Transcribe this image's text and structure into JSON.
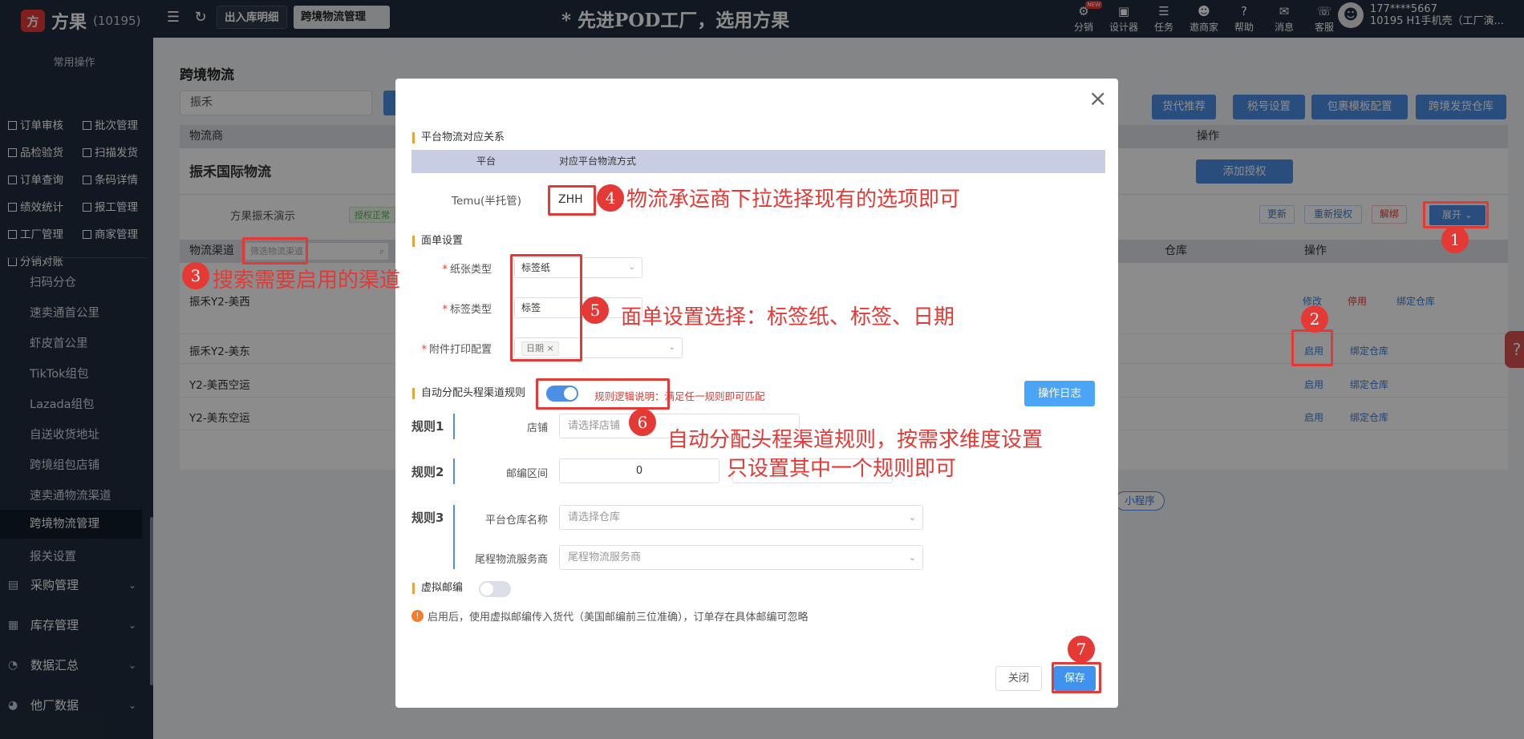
{
  "app": {
    "brand": "方果",
    "brand_count": "(10195)",
    "logo_glyph": "方"
  },
  "top_tabs": [
    "出入库明细",
    "跨境物流管理"
  ],
  "slogan": "* 先进POD工厂，选用方果",
  "top_menu": [
    {
      "label": "分销",
      "icon": "share-icon",
      "glyph": "⚙",
      "badge": "NEW"
    },
    {
      "label": "设计器",
      "icon": "image-icon",
      "glyph": "▣"
    },
    {
      "label": "任务",
      "icon": "task-icon",
      "glyph": "☰"
    },
    {
      "label": "邀商家",
      "icon": "users-icon",
      "glyph": "☻"
    },
    {
      "label": "帮助",
      "icon": "help-icon",
      "glyph": "?"
    },
    {
      "label": "消息",
      "icon": "message-icon",
      "glyph": "✉"
    },
    {
      "label": "客服",
      "icon": "headset-icon",
      "glyph": "☏"
    }
  ],
  "user": {
    "phone": "177****5667",
    "org": "10195  H1手机壳（工厂演..."
  },
  "sidebar": {
    "heading": "常用操作",
    "quick": [
      [
        "订单审核",
        "批次管理"
      ],
      [
        "品检验货",
        "扫描发货"
      ],
      [
        "订单查询",
        "条码详情"
      ],
      [
        "绩效统计",
        "报工管理"
      ],
      [
        "工厂管理",
        "商家管理"
      ],
      [
        "分销对账",
        ""
      ]
    ],
    "items": [
      "扫码分仓",
      "速卖通首公里",
      "虾皮首公里",
      "TikTok组包",
      "Lazada组包",
      "自送收货地址",
      "跨境组包店铺",
      "速卖通物流渠道",
      "跨境物流管理",
      "报关设置"
    ],
    "active": "跨境物流管理",
    "groups": [
      "采购管理",
      "库存管理",
      "数据汇总",
      "他厂数据"
    ]
  },
  "page": {
    "title": "跨境物流",
    "search_value": "振禾",
    "top_buttons": [
      "货代推荐",
      "税号设置",
      "包裹模板配置",
      "跨境发货仓库"
    ],
    "carrier_header": "物流商",
    "ops_header": "操作",
    "carrier_name": "振禾国际物流",
    "add_auth": "添加授权",
    "account_name": "方果振禾演示",
    "auth_status": "授权正常",
    "account_actions": [
      "更新",
      "重新授权",
      "解绑"
    ],
    "expand": "展开",
    "channel_header": "物流渠道",
    "channel_search_placeholder": "筛选物流渠道",
    "warehouse_header": "仓库",
    "channel_ops_header": "操作",
    "channels": [
      {
        "name": "振禾Y2-美西",
        "actions": [
          "修改",
          "停用",
          "绑定仓库"
        ]
      },
      {
        "name": "振禾Y2-美东",
        "actions": [
          "启用",
          "绑定仓库"
        ]
      },
      {
        "name": "Y2-美西空运",
        "actions": [
          "启用",
          "绑定仓库"
        ]
      },
      {
        "name": "Y2-美东空运",
        "actions": [
          "启用",
          "绑定仓库"
        ]
      }
    ],
    "mini_program": "小程序",
    "help_tab": "?"
  },
  "modal": {
    "close": "×",
    "sec1": "平台物流对应关系",
    "th_platform": "平台",
    "th_mapping": "对应平台物流方式",
    "platform": "Temu(半托管)",
    "mapping_value": "ZHH",
    "sec2": "面单设置",
    "paper_label": "纸张类型",
    "paper_value": "标签纸",
    "label_label": "标签类型",
    "label_value": "标签",
    "attach_label": "附件打印配置",
    "attach_tag": "日期",
    "sec3": "自动分配头程渠道规则",
    "rule_logic_label": "规则逻辑说明：",
    "rule_logic_value": "满足任一规则即可匹配",
    "log_btn": "操作日志",
    "rule1": "规则1",
    "shop_label": "店铺",
    "shop_placeholder": "请选择店铺",
    "rule2": "规则2",
    "zip_label": "邮编区间",
    "zip_value": "0",
    "rule3": "规则3",
    "wh_label": "平台仓库名称",
    "wh_placeholder": "请选择仓库",
    "tail_label": "尾程物流服务商",
    "tail_placeholder": "尾程物流服务商",
    "virtual_zip": "虚拟邮编",
    "virtual_zip_on": false,
    "auto_rule_on": true,
    "notice": "启用后，使用虚拟邮编传入货代（美国邮编前三位准确），订单存在具体邮编可忽略",
    "cancel": "关闭",
    "save": "保存"
  },
  "annotations": {
    "n1": "1",
    "n2": "2",
    "n3": "3",
    "n4": "4",
    "n5": "5",
    "n6": "6",
    "n7": "7",
    "t3": "搜索需要启用的渠道",
    "t4": "物流承运商下拉选择现有的选项即可",
    "t5": "面单设置选择：标签纸、标签、日期",
    "t6a": "自动分配头程渠道规则，按需求维度设置",
    "t6b": "只设置其中一个规则即可"
  },
  "colors": {
    "accent": "#4b8fe6",
    "sidebar": "#1f2d3d",
    "annotation": "#e53935"
  }
}
